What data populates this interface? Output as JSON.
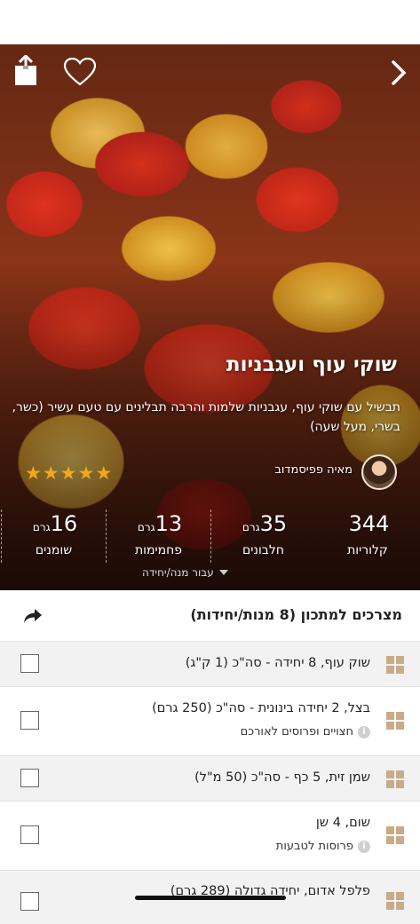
{
  "recipe": {
    "title": "שוקי עוף ועגבניות",
    "description": "תבשיל עם שוקי עוף, עגבניות שלמות והרבה תבלינים עם טעם עשיר (כשר, בשרי, מעל שעה)",
    "author": "מאיה פפיסמדוב",
    "rating": 5
  },
  "stats": [
    {
      "value": "344",
      "unit": "",
      "label": "קלוריות"
    },
    {
      "value": "35",
      "unit": "גרם",
      "label": "חלבונים"
    },
    {
      "value": "13",
      "unit": "גרם",
      "label": "פחמימות"
    },
    {
      "value": "16",
      "unit": "גרם",
      "label": "שומנים"
    }
  ],
  "per_toggle": "עבור מנה/יחידה",
  "ingredients": {
    "header": "מצרכים למתכון (8 מנות/יחידות)",
    "items": [
      {
        "text": "שוק עוף, 8 יחידה - סה\"כ (1 ק\"ג)",
        "note": ""
      },
      {
        "text": "בצל, 2 יחידה בינונית - סה\"כ (250 גרם)",
        "note": "חצויים ופרוסים לאורכם"
      },
      {
        "text": "שמן זית, 5 כף - סה\"כ (50 מ\"ל)",
        "note": ""
      },
      {
        "text": "שום, 4 שן",
        "note": "פרוסות לטבעות"
      },
      {
        "text": "פלפל אדום, יחידה גדולה (289 גרם)",
        "note": ""
      }
    ]
  },
  "icons": {
    "share": "share-icon",
    "heart": "heart-icon",
    "back": "chevron-right-icon",
    "info": "i"
  },
  "colors": {
    "star": "#f0a81c",
    "grid_icon": "#c9ab8a"
  }
}
